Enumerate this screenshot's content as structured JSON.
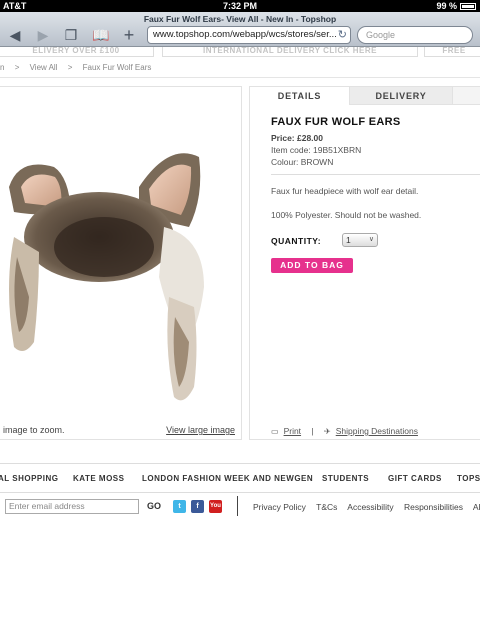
{
  "status_bar": {
    "carrier": "AT&T",
    "time": "7:32 PM",
    "battery": "99 %"
  },
  "browser": {
    "page_title": "Faux Fur Wolf Ears- View All - New In - Topshop",
    "url": "www.topshop.com/webapp/wcs/stores/ser...",
    "search_placeholder": "Google"
  },
  "promo": {
    "left": "ELIVERY OVER £100",
    "middle": "INTERNATIONAL DELIVERY CLICK HERE",
    "right": "FREE"
  },
  "breadcrumb": [
    "n",
    ">",
    "View All",
    ">",
    "Faux Fur Wolf Ears"
  ],
  "image_panel": {
    "zoom_hint": "image to zoom.",
    "large_link": "View large image"
  },
  "tabs": {
    "details": "DETAILS",
    "delivery": "DELIVERY"
  },
  "product": {
    "name": "FAUX FUR WOLF EARS",
    "price": "Price: £28.00",
    "item_code": "Item code:  19B51XBRN",
    "colour": "Colour:  BROWN",
    "description": "Faux fur headpiece with wolf ear detail.",
    "fabric": "100% Polyester. Should not be washed.",
    "quantity_label": "QUANTITY:",
    "quantity_value": "1",
    "add_to_bag": "ADD TO BAG",
    "print": "Print",
    "shipping": "Shipping Destinations"
  },
  "footer_nav": [
    "AL SHOPPING",
    "KATE MOSS",
    "LONDON FASHION WEEK AND NEWGEN",
    "STUDENTS",
    "GIFT CARDS",
    "TOPS"
  ],
  "footer": {
    "email_placeholder": "Enter email address",
    "go": "GO",
    "links": [
      "Privacy Policy",
      "T&Cs",
      "Accessibility",
      "Responsibilities",
      "Ab"
    ]
  },
  "colors": {
    "accent": "#e6318d"
  }
}
